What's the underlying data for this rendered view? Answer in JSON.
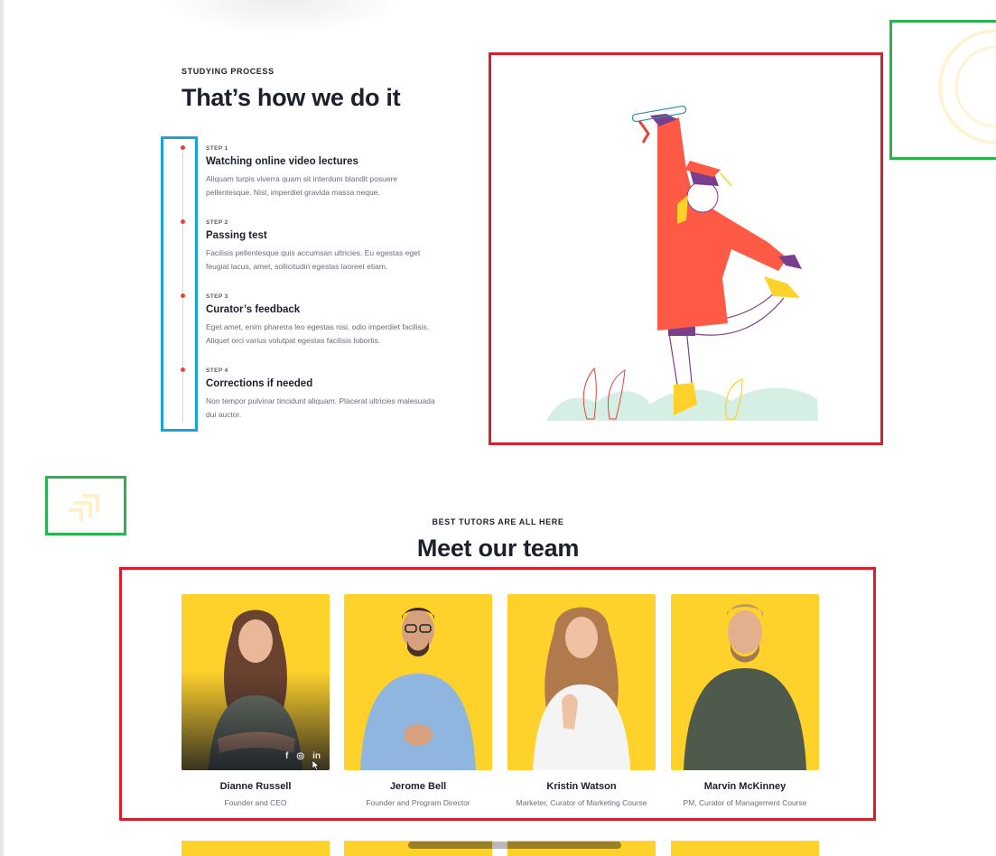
{
  "process": {
    "eyebrow": "STUDYING PROCESS",
    "title": "That’s how we do it",
    "steps": [
      {
        "label": "STEP 1",
        "title": "Watching online video lectures",
        "desc": "Aliquam turpis viverra quam sit interdum blandit posuere pellentesque. Nisl, imperdiet gravida massa neque."
      },
      {
        "label": "STEP 2",
        "title": "Passing test",
        "desc": "Facilisis pellentesque quis accumsan ultricies. Eu egestas eget feugiat lacus, amet, sollicitudin egestas laoreet etiam."
      },
      {
        "label": "STEP 3",
        "title": "Curator’s feedback",
        "desc": "Eget amet, enim pharetra leo egestas nisi, odio imperdiet facilisis. Aliquet orci varius volutpat egestas facilisis lobortis."
      },
      {
        "label": "STEP 4",
        "title": "Corrections if needed",
        "desc": "Non tempor pulvinar tincidunt aliquam. Placerat ultricies malesuada dui auctor."
      }
    ]
  },
  "team": {
    "eyebrow": "BEST TUTORS ARE ALL HERE",
    "title": "Meet our team",
    "members": [
      {
        "name": "Dianne Russell",
        "role": "Founder and CEO"
      },
      {
        "name": "Jerome Bell",
        "role": "Founder and Program Director"
      },
      {
        "name": "Kristin Watson",
        "role": "Marketer, Curator of Marketing Course"
      },
      {
        "name": "Marvin McKinney",
        "role": "PM, Curator of Management Course"
      }
    ],
    "socials": [
      "f",
      "◎",
      "in"
    ]
  },
  "colors": {
    "accent": "#e8413c",
    "card_bg": "#ffd22b",
    "annot_red": "#d7202b",
    "annot_blue": "#1aa3d9",
    "annot_green": "#2bb34d"
  }
}
